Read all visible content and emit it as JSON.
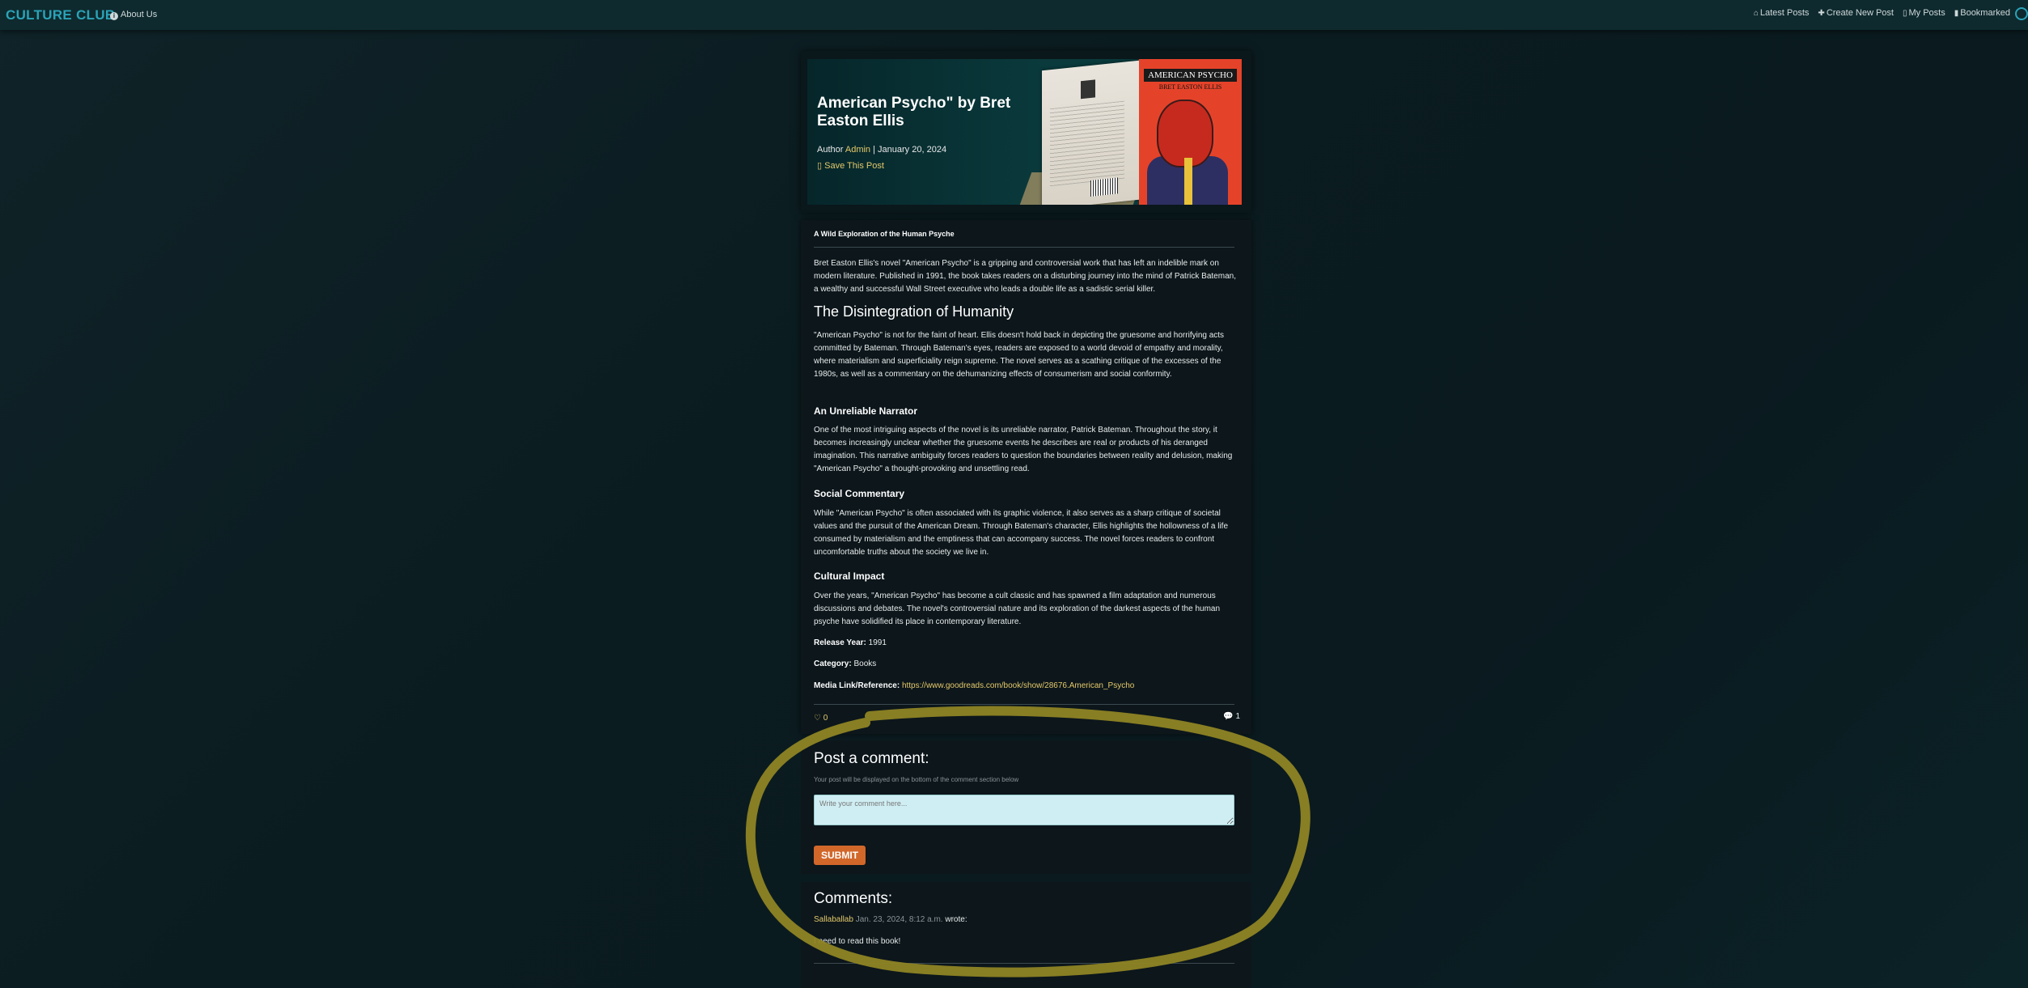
{
  "navbar": {
    "brand": "CULTURE CLUB",
    "about": "About Us",
    "links": [
      "Latest Posts",
      "Create New Post",
      "My Posts",
      "Bookmarked"
    ]
  },
  "hero": {
    "title": "American Psycho\" by Bret Easton Ellis",
    "author_prefix": "Author",
    "author": "Admin",
    "date_sep": "|",
    "date": "January 20, 2024",
    "save": "Save This Post",
    "book_title": "AMERICAN PSYCHO",
    "book_author": "BRET EASTON ELLIS"
  },
  "post": {
    "subtitle": "A Wild Exploration of the Human Psyche",
    "intro": "Bret Easton Ellis's novel \"American Psycho\" is a gripping and controversial work that has left an indelible mark on modern literature. Published in 1991, the book takes readers on a disturbing journey into the mind of Patrick Bateman, a wealthy and successful Wall Street executive who leads a double life as a sadistic serial killer.",
    "h_disintegration": "The Disintegration of Humanity",
    "p_disintegration": "\"American Psycho\" is not for the faint of heart. Ellis doesn't hold back in depicting the gruesome and horrifying acts committed by Bateman. Through Bateman's eyes, readers are exposed to a world devoid of empathy and morality, where materialism and superficiality reign supreme. The novel serves as a scathing critique of the excesses of the 1980s, as well as a commentary on the dehumanizing effects of consumerism and social conformity.",
    "h_narrator": "An Unreliable Narrator",
    "p_narrator": "One of the most intriguing aspects of the novel is its unreliable narrator, Patrick Bateman. Throughout the story, it becomes increasingly unclear whether the gruesome events he describes are real or products of his deranged imagination. This narrative ambiguity forces readers to question the boundaries between reality and delusion, making \"American Psycho\" a thought-provoking and unsettling read.",
    "h_social": "Social Commentary",
    "p_social": "While \"American Psycho\" is often associated with its graphic violence, it also serves as a sharp critique of societal values and the pursuit of the American Dream. Through Bateman's character, Ellis highlights the hollowness of a life consumed by materialism and the emptiness that can accompany success. The novel forces readers to confront uncomfortable truths about the society we live in.",
    "h_cultural": "Cultural Impact",
    "p_cultural": "Over the years, \"American Psycho\" has become a cult classic and has spawned a film adaptation and numerous discussions and debates. The novel's controversial nature and its exploration of the darkest aspects of the human psyche have solidified its place in contemporary literature.",
    "release_label": "Release Year:",
    "release_value": "1991",
    "category_label": "Category:",
    "category_value": "Books",
    "media_label": "Media Link/Reference:",
    "media_value": "https://www.goodreads.com/book/show/28676.American_Psycho",
    "likes": "0",
    "comment_count": "1"
  },
  "comment_form": {
    "title": "Post a comment:",
    "hint": "Your post will be displayed on the bottom of the comment section below",
    "placeholder": "Write your comment here...",
    "submit": "SUBMIT"
  },
  "comments": {
    "title": "Comments:",
    "items": [
      {
        "user": "Sallaballab",
        "date": "Jan. 23, 2024, 8:12 a.m.",
        "wrote": "wrote:",
        "body": "I need to read this book!"
      }
    ]
  },
  "colors": {
    "brand": "#2aa3b8",
    "accent": "#e5c96a",
    "submit": "#d2672a",
    "highlight": "#8f8424"
  }
}
